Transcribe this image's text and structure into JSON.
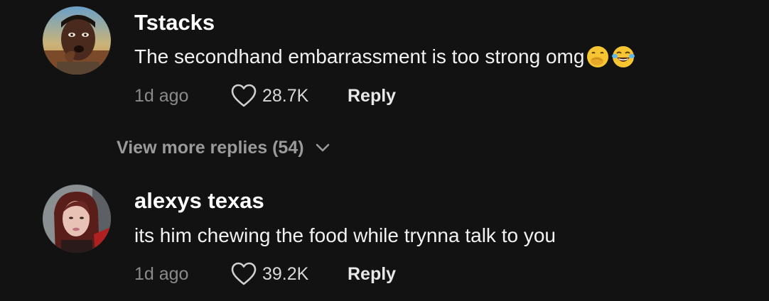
{
  "comments": [
    {
      "username": "Tstacks",
      "text": "The secondhand embarrassment is too strong omg",
      "emojis": [
        "face-with-hand-over-mouth-emoji",
        "face-with-tears-of-joy-emoji"
      ],
      "time": "1d ago",
      "likes": "28.7K",
      "reply_label": "Reply",
      "like_icon": "heart-outline-icon"
    },
    {
      "username": "alexys texas",
      "text": "its him chewing the food while trynna talk to you",
      "time": "1d ago",
      "likes": "39.2K",
      "reply_label": "Reply",
      "like_icon": "heart-outline-icon"
    }
  ],
  "view_more": {
    "label": "View more replies (54)",
    "icon": "chevron-down-icon"
  },
  "colors": {
    "background": "#121212",
    "username": "#ffffff",
    "text": "#f2f2f2",
    "muted": "#8a8a8a"
  }
}
